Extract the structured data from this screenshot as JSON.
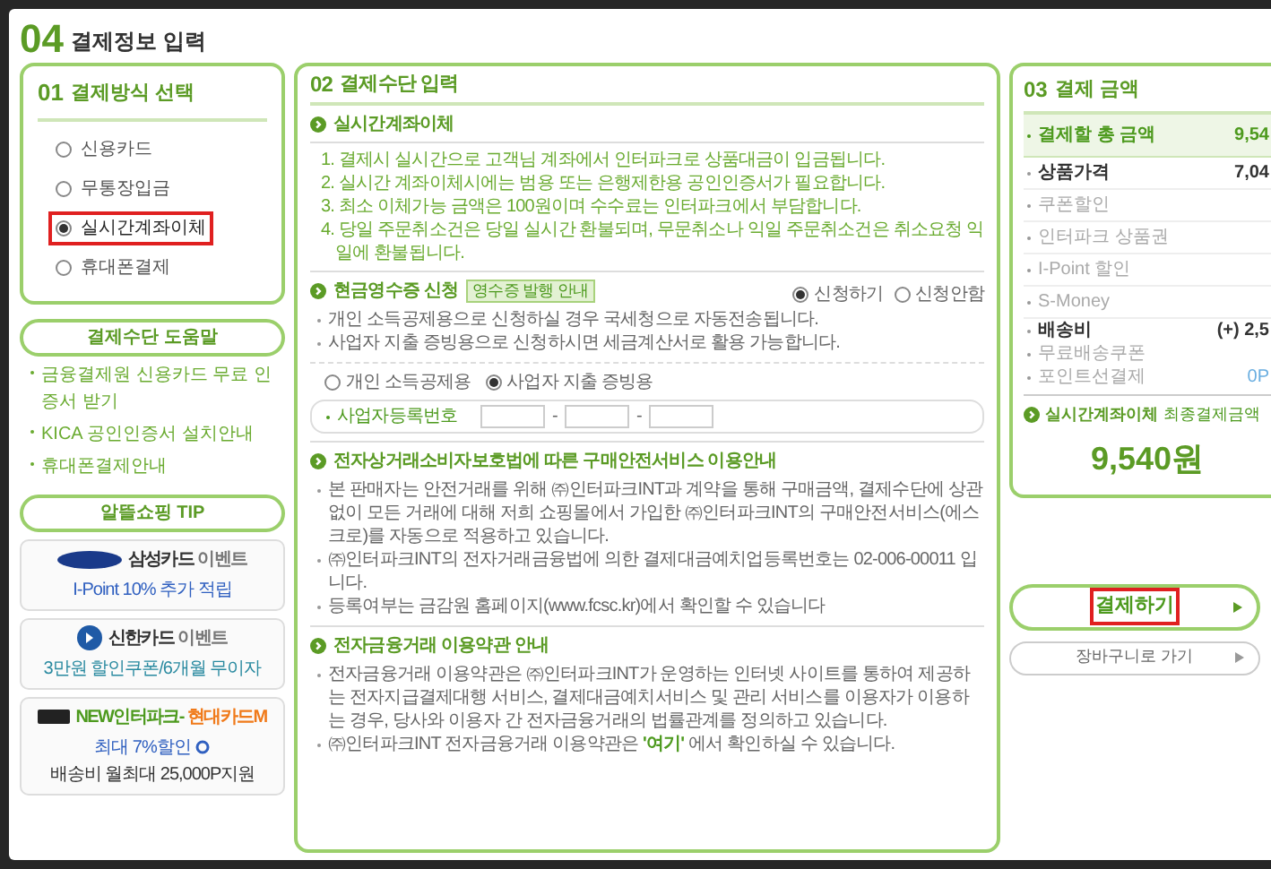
{
  "page_title": {
    "number": "04",
    "text": "결제정보 입력"
  },
  "method_panel": {
    "number": "01",
    "title": "결제방식 선택",
    "options": [
      {
        "label": "신용카드",
        "selected": false,
        "highlighted": false
      },
      {
        "label": "무통장입금",
        "selected": false,
        "highlighted": false
      },
      {
        "label": "실시간계좌이체",
        "selected": true,
        "highlighted": true
      },
      {
        "label": "휴대폰결제",
        "selected": false,
        "highlighted": false
      }
    ]
  },
  "help": {
    "title": "결제수단 도움말",
    "links": [
      "금융결제원 신용카드 무료 인증서 받기",
      "KICA 공인인증서 설치안내",
      "휴대폰결제안내"
    ]
  },
  "tip": {
    "title": "알뜰쇼핑 TIP",
    "banners": [
      {
        "kind": "samsung",
        "title": [
          {
            "text": "삼성카드",
            "color": "#333333"
          },
          {
            "text": "이벤트",
            "color": "#777777"
          }
        ],
        "line": [
          {
            "text": "I-Point 10% 추가 적립",
            "color": "#3060c0"
          }
        ]
      },
      {
        "kind": "shinhan",
        "title": [
          {
            "text": "신한카드",
            "color": "#333333"
          },
          {
            "text": "이벤트",
            "color": "#777777"
          }
        ],
        "line": [
          {
            "text": "3만원 할인쿠폰/6개월 무이자",
            "color": "#2a8aa0"
          }
        ]
      },
      {
        "kind": "hyundai",
        "title": [
          {
            "text": "NEW인터파크-",
            "color": "#4d9a1e"
          },
          {
            "text": "현대카드M",
            "color": "#f07a1a"
          }
        ],
        "line": [
          {
            "text": "최대 7%할인",
            "color": "#3060c0"
          },
          {
            "text": "배송비 월최대 25,000P지원",
            "color": "#333333"
          }
        ]
      }
    ]
  },
  "input_panel": {
    "number": "02",
    "title": "결제수단 입력",
    "transfer": {
      "title": "실시간계좌이체",
      "steps": [
        "1. 결제시 실시간으로 고객님 계좌에서 인터파크로 상품대금이 입금됩니다.",
        "2. 실시간 계좌이체시에는 범용 또는 은행제한용 공인인증서가 필요합니다.",
        "3. 최소 이체가능 금액은 100원이며 수수료는 인터파크에서 부담합니다.",
        "4. 당일 주문취소건은 당일 실시간 환불되며, 무문취소나 익일 주문취소건은 취소요청 익일에 환불됩니다."
      ]
    },
    "receipt": {
      "title": "현금영수증 신청",
      "badge": "영수증 발행 안내",
      "choices": [
        {
          "label": "신청하기",
          "selected": true
        },
        {
          "label": "신청안함",
          "selected": false
        }
      ],
      "notes": [
        "개인 소득공제용으로 신청하실 경우 국세청으로 자동전송됩니다.",
        "사업자 지출 증빙용으로 신청하시면 세금계산서로 활용 가능합니다."
      ],
      "types": [
        {
          "label": "개인 소득공제용",
          "selected": false
        },
        {
          "label": "사업자 지출 증빙용",
          "selected": true
        }
      ],
      "field_label": "사업자등록번호",
      "separator": "-"
    },
    "escrow": {
      "title": "전자상거래소비자보호법에 따른 구매안전서비스 이용안내",
      "bullets": [
        "본 판매자는 안전거래를 위해 ㈜인터파크INT과 계약을 통해 구매금액, 결제수단에 상관없이 모든 거래에 대해 저희 쇼핑몰에서 가입한 ㈜인터파크INT의 구매안전서비스(에스크로)를 자동으로 적용하고 있습니다.",
        "㈜인터파크INT의 전자거래금융법에 의한 결제대금예치업등록번호는 02-006-00011 입니다.",
        "등록여부는 금감원 홈페이지(www.fcsc.kr)에서 확인할 수 있습니다"
      ]
    },
    "terms": {
      "title": "전자금융거래 이용약관 안내",
      "bullet": "전자금융거래 이용약관은 ㈜인터파크INT가 운영하는 인터넷 사이트를 통하여 제공하는 전자지급결제대행 서비스, 결제대금예치서비스 및 관리 서비스를 이용자가 이용하는 경우, 당사와 이용자 간 전자금융거래의 법률관계를 정의하고 있습니다.",
      "link_before": "㈜인터파크INT 전자금융거래 이용약관은",
      "link": "'여기'",
      "link_after": "에서 확인하실 수 있습니다."
    }
  },
  "amount_panel": {
    "number": "03",
    "title": "결제 금액",
    "total": {
      "label": "결제할 총 금액",
      "value": "9,54"
    },
    "rows": [
      {
        "label": "상품가격",
        "value": "7,04",
        "emphasized": true
      },
      {
        "label": "쿠폰할인",
        "emphasized": false
      },
      {
        "label": "인터파크 상품권",
        "emphasized": false
      },
      {
        "label": "I-Point 할인",
        "emphasized": false
      },
      {
        "label": "S-Money",
        "emphasized": false
      },
      {
        "label": "배송비",
        "value": "(+) 2,5",
        "emphasized": true
      },
      {
        "label": "무료배송쿠폰",
        "emphasized": false
      },
      {
        "label": "포인트선결제",
        "value": "0P",
        "emphasized": false
      }
    ],
    "final_method": "실시간계좌이체",
    "final_label": "최종결제금액",
    "final_amount": "9,540원"
  },
  "buttons": [
    {
      "label": "결제하기",
      "kind": "primary",
      "highlighted": true
    },
    {
      "label": "장바구니로 가기",
      "kind": "secondary",
      "highlighted": false
    }
  ]
}
